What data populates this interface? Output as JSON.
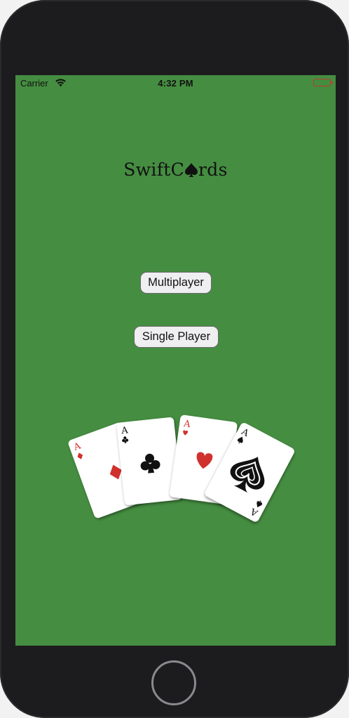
{
  "status_bar": {
    "carrier": "Carrier",
    "time": "4:32 PM",
    "icons": [
      "wifi-icon",
      "battery-icon"
    ]
  },
  "app": {
    "logo_left": "SwiftC",
    "logo_right": "rds",
    "logo_mark": "spade-icon"
  },
  "menu": {
    "multiplayer_label": "Multiplayer",
    "single_player_label": "Single Player"
  },
  "cards": [
    {
      "rank": "A",
      "suit": "diamonds",
      "color": "#d0312d"
    },
    {
      "rank": "A",
      "suit": "clubs",
      "color": "#111111"
    },
    {
      "rank": "A",
      "suit": "hearts",
      "color": "#d0312d"
    },
    {
      "rank": "A",
      "suit": "spades",
      "color": "#111111"
    }
  ],
  "colors": {
    "screen_background": "#458d41",
    "device_frame": "#1c1c1e",
    "button_background": "#efeff1"
  }
}
